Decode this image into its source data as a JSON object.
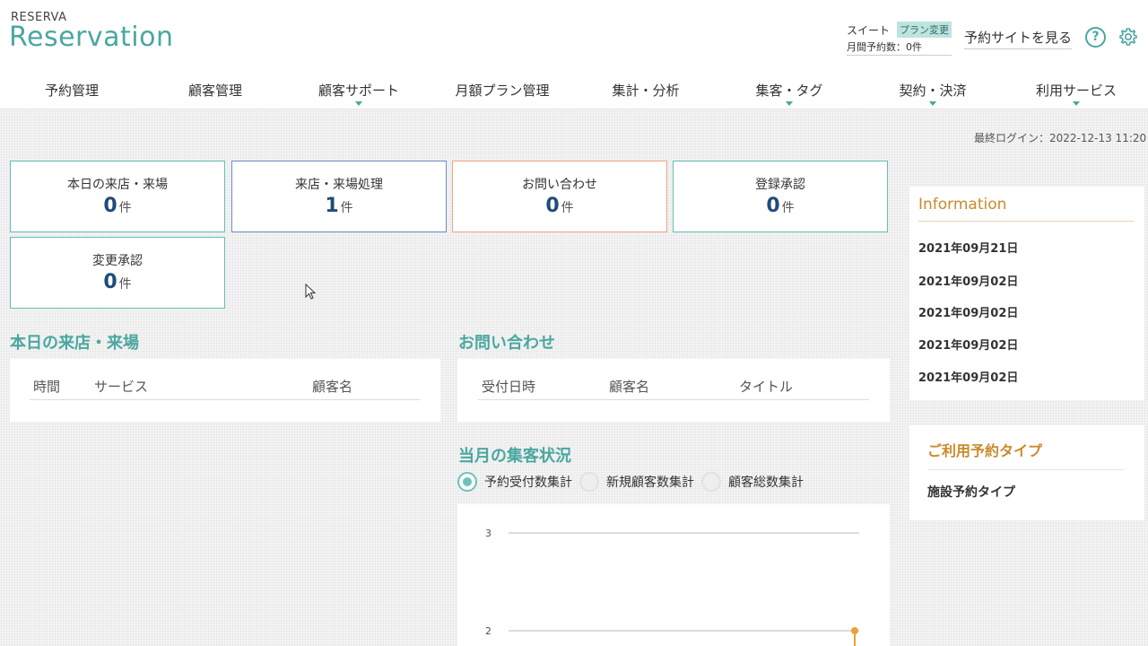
{
  "header": {
    "logo_small": "RESERVA",
    "logo_main": "Reservation",
    "plan_name": "スイート",
    "plan_change": "プラン変更",
    "monthly_reservations": "月間予約数：0件",
    "view_site": "予約サイトを見る",
    "help_icon": "?",
    "icons": [
      "help-icon",
      "gear-icon"
    ]
  },
  "nav": [
    {
      "label": "予約管理",
      "has_dropdown": false
    },
    {
      "label": "顧客管理",
      "has_dropdown": false
    },
    {
      "label": "顧客サポート",
      "has_dropdown": true
    },
    {
      "label": "月額プラン管理",
      "has_dropdown": false
    },
    {
      "label": "集計・分析",
      "has_dropdown": false
    },
    {
      "label": "集客・タグ",
      "has_dropdown": true
    },
    {
      "label": "契約・決済",
      "has_dropdown": true
    },
    {
      "label": "利用サービス",
      "has_dropdown": true
    }
  ],
  "last_login": "最終ログイン：2022-12-13 11:20",
  "stats": [
    {
      "label": "本日の来店・来場",
      "value": "0",
      "unit": "件",
      "color": "#66bdb5"
    },
    {
      "label": "来店・来場処理",
      "value": "1",
      "unit": "件",
      "color": "#6a8ec3"
    },
    {
      "label": "お問い合わせ",
      "value": "0",
      "unit": "件",
      "color": "#f0a585"
    },
    {
      "label": "登録承認",
      "value": "0",
      "unit": "件",
      "color": "#66bdb5"
    },
    {
      "label": "変更承認",
      "value": "0",
      "unit": "件",
      "color": "#66bdb5"
    }
  ],
  "today_visits": {
    "title": "本日の来店・来場",
    "columns": [
      "時間",
      "サービス",
      "顧客名"
    ]
  },
  "inquiries": {
    "title": "お問い合わせ",
    "columns": [
      "受付日時",
      "顧客名",
      "タイトル"
    ]
  },
  "monthly": {
    "title": "当月の集客状況",
    "options": [
      {
        "label": "予約受付数集計",
        "selected": true
      },
      {
        "label": "新規顧客数集計",
        "selected": false
      },
      {
        "label": "顧客総数集計",
        "selected": false
      }
    ]
  },
  "chart_data": {
    "type": "line",
    "y_ticks": [
      "3",
      "2"
    ],
    "series": [
      {
        "values": [
          2
        ]
      }
    ],
    "grid": true
  },
  "information": {
    "title": "Information",
    "items": [
      "2021年09月21日",
      "2021年09月02日",
      "2021年09月02日",
      "2021年09月02日",
      "2021年09月02日"
    ]
  },
  "reservation_type": {
    "title": "ご利用予約タイプ",
    "item": "施設予約タイプ"
  },
  "colors": {
    "accent": "#4aa7a0",
    "info_accent": "#c98a2e",
    "chart_line": "#f0a030"
  }
}
